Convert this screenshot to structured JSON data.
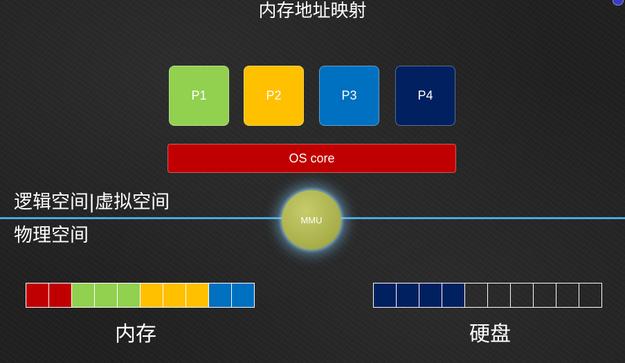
{
  "title": "内存地址映射",
  "processes": [
    {
      "label": "P1",
      "color": "#92d050"
    },
    {
      "label": "P2",
      "color": "#ffc000"
    },
    {
      "label": "P3",
      "color": "#0070c0"
    },
    {
      "label": "P4",
      "color": "#002060"
    }
  ],
  "os_core": {
    "label": "OS core",
    "color": "#c00000"
  },
  "logical_space_label": "逻辑空间|虚拟空间",
  "physical_space_label": "物理空间",
  "mmu_label": "MMU",
  "memory": {
    "label": "内存",
    "blocks": [
      "#c00000",
      "#c00000",
      "#92d050",
      "#92d050",
      "#92d050",
      "#ffc000",
      "#ffc000",
      "#ffc000",
      "#0070c0",
      "#0070c0"
    ]
  },
  "disk": {
    "label": "硬盘",
    "blocks": [
      "#002060",
      "#002060",
      "#002060",
      "#002060",
      "",
      "",
      "",
      "",
      "",
      ""
    ]
  }
}
